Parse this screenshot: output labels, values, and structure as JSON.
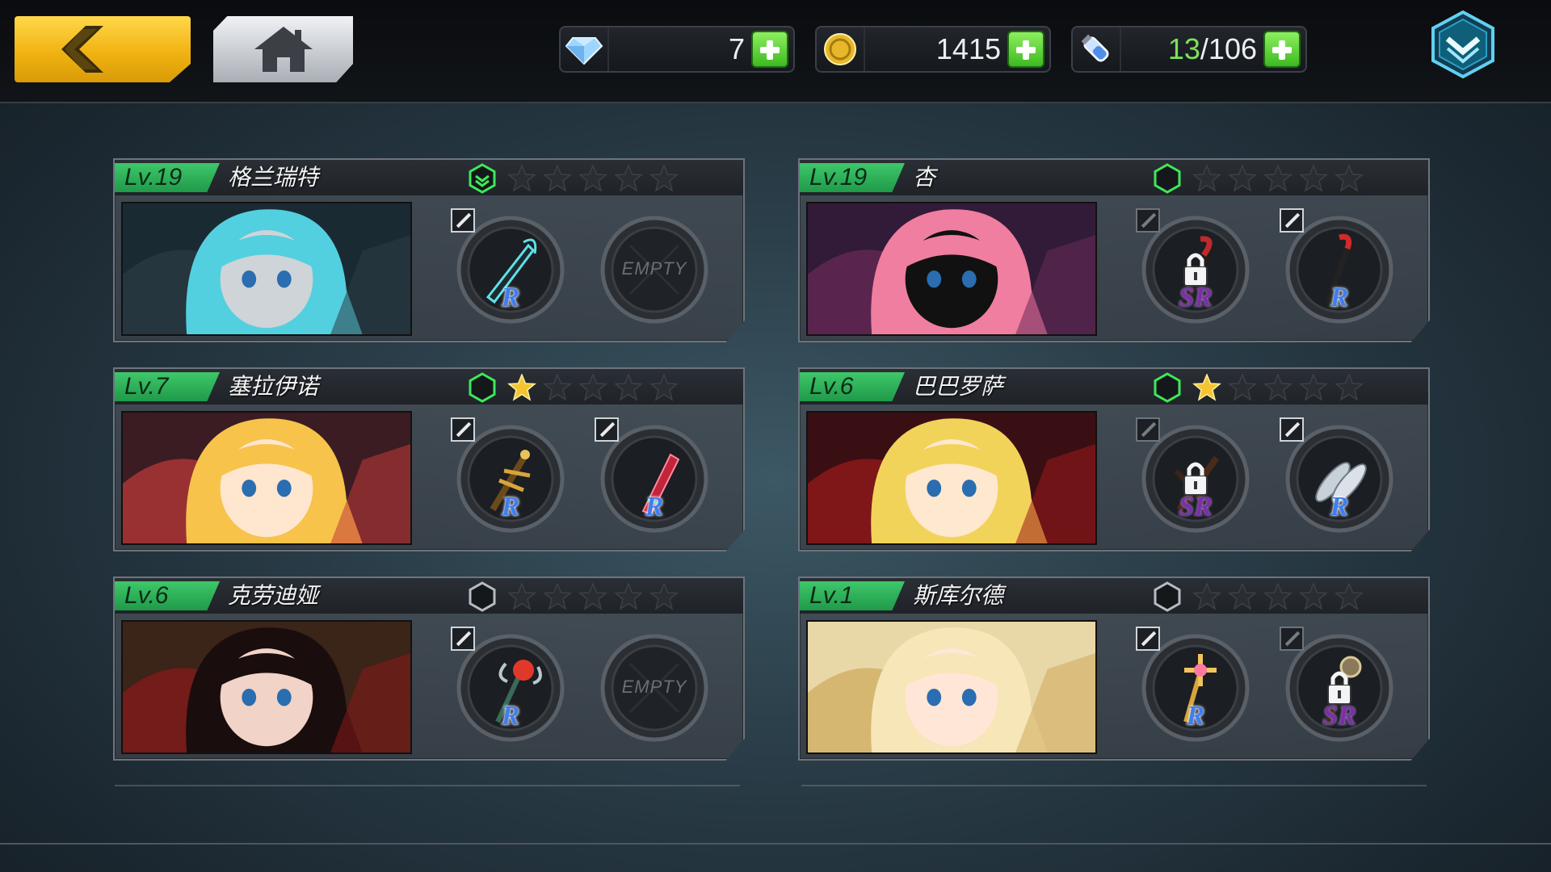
{
  "currency": {
    "gems": "7",
    "gold": "1415",
    "stamina_current": "13",
    "stamina_max": "/106"
  },
  "colors": {
    "accent_gold": "#f1b312",
    "level_green": "#2fb85a",
    "rarity_r": "#3e7ef2",
    "rarity_sr": "#7b2fa8"
  },
  "characters": [
    {
      "level": "Lv.19",
      "name": "格兰瑞特",
      "rank_icon": "green-chevron-hex-icon",
      "stars_filled": 0,
      "stars_total": 5,
      "slots": [
        {
          "type": "weapon",
          "rarity": "R",
          "locked": false,
          "icon": "dagger-icon"
        },
        {
          "type": "empty",
          "label": "EMPTY"
        }
      ]
    },
    {
      "level": "Lv.19",
      "name": "杏",
      "rank_icon": "green-hex-icon",
      "stars_filled": 0,
      "stars_total": 5,
      "slots": [
        {
          "type": "weapon",
          "rarity": "SR",
          "locked": true,
          "icon": "hook-icon"
        },
        {
          "type": "weapon",
          "rarity": "R",
          "locked": false,
          "icon": "crowbar-icon"
        }
      ]
    },
    {
      "level": "Lv.7",
      "name": "塞拉伊诺",
      "rank_icon": "green-hex-icon",
      "stars_filled": 1,
      "stars_total": 5,
      "slots": [
        {
          "type": "weapon",
          "rarity": "R",
          "locked": false,
          "icon": "ornate-sword-icon"
        },
        {
          "type": "weapon",
          "rarity": "R",
          "locked": false,
          "icon": "red-blade-icon"
        }
      ]
    },
    {
      "level": "Lv.6",
      "name": "巴巴罗萨",
      "rank_icon": "green-hex-icon",
      "stars_filled": 1,
      "stars_total": 5,
      "slots": [
        {
          "type": "weapon",
          "rarity": "SR",
          "locked": true,
          "icon": "musket-icon"
        },
        {
          "type": "weapon",
          "rarity": "R",
          "locked": false,
          "icon": "fish-icon"
        }
      ]
    },
    {
      "level": "Lv.6",
      "name": "克劳迪娅",
      "rank_icon": "gray-hex-icon",
      "stars_filled": 0,
      "stars_total": 5,
      "slots": [
        {
          "type": "weapon",
          "rarity": "R",
          "locked": false,
          "icon": "rose-staff-icon"
        },
        {
          "type": "empty",
          "label": "EMPTY"
        }
      ]
    },
    {
      "level": "Lv.1",
      "name": "斯库尔德",
      "rank_icon": "gray-hex-icon",
      "stars_filled": 0,
      "stars_total": 5,
      "slots": [
        {
          "type": "weapon",
          "rarity": "R",
          "locked": false,
          "icon": "golden-scepter-icon"
        },
        {
          "type": "weapon",
          "rarity": "SR",
          "locked": true,
          "icon": "spiked-staff-icon"
        }
      ]
    }
  ]
}
